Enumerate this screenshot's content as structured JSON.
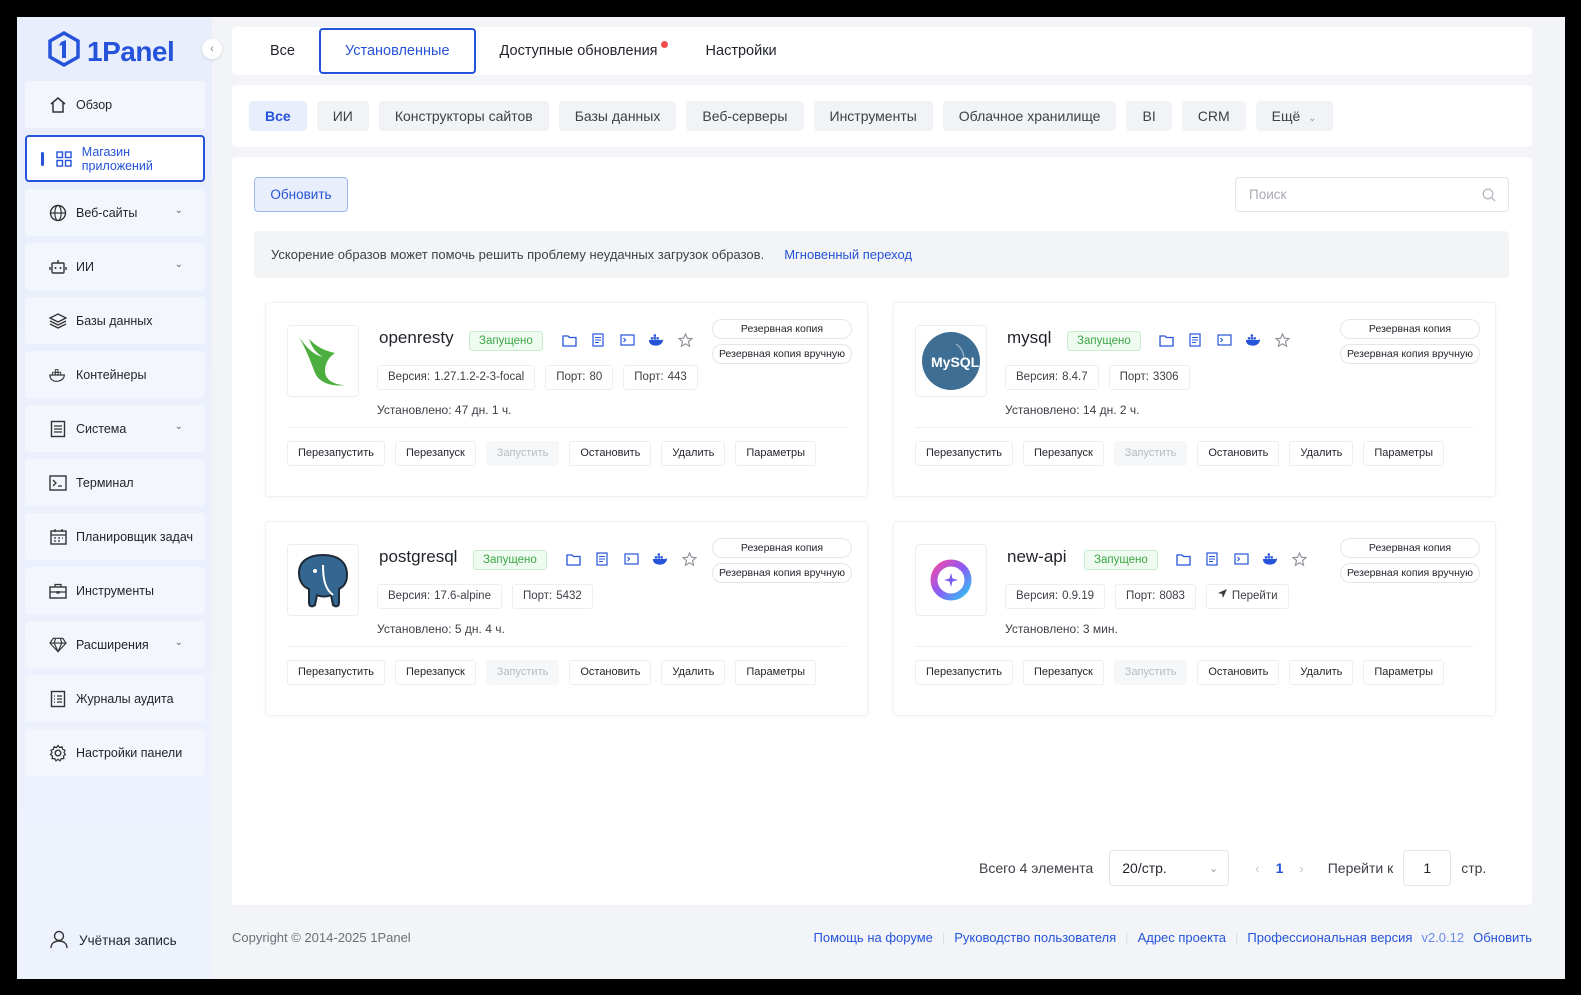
{
  "brand": {
    "name": "1Panel"
  },
  "sidebar": {
    "items": [
      {
        "label": "Обзор"
      },
      {
        "label": "Магазин приложений"
      },
      {
        "label": "Веб-сайты"
      },
      {
        "label": "ИИ"
      },
      {
        "label": "Базы данных"
      },
      {
        "label": "Контейнеры"
      },
      {
        "label": "Система"
      },
      {
        "label": "Терминал"
      },
      {
        "label": "Планировщик задач"
      },
      {
        "label": "Инструменты"
      },
      {
        "label": "Расширения"
      },
      {
        "label": "Журналы аудита"
      },
      {
        "label": "Настройки панели"
      }
    ],
    "account": "Учётная запись"
  },
  "top_tabs": [
    "Все",
    "Установленные",
    "Доступные обновления",
    "Настройки"
  ],
  "categories": [
    "Все",
    "ИИ",
    "Конструкторы сайтов",
    "Базы данных",
    "Веб-серверы",
    "Инструменты",
    "Облачное хранилище",
    "BI",
    "CRM",
    "Ещё"
  ],
  "toolbar": {
    "refresh": "Обновить",
    "search_placeholder": "Поиск"
  },
  "notice": {
    "text": "Ускорение образов может помочь решить проблему неудачных загрузок образов.",
    "link": "Мгновенный переход"
  },
  "common": {
    "status": "Запущено",
    "backup": "Резервная копия",
    "manual_backup": "Резервная копия вручную",
    "version_label": "Версия:",
    "port_label": "Порт:",
    "installed_label": "Установлено:",
    "goto": "Перейти",
    "actions": [
      "Перезапустить",
      "Перезапуск",
      "Запустить",
      "Остановить",
      "Удалить",
      "Параметры"
    ]
  },
  "apps": [
    {
      "name": "openresty",
      "version": "1.27.1.2-2-3-focal",
      "ports": [
        "80",
        "443"
      ],
      "installed": "47 дн. 1 ч."
    },
    {
      "name": "mysql",
      "version": "8.4.7",
      "ports": [
        "3306"
      ],
      "installed": "14 дн. 2 ч."
    },
    {
      "name": "postgresql",
      "version": "17.6-alpine",
      "ports": [
        "5432"
      ],
      "installed": "5 дн. 4 ч."
    },
    {
      "name": "new-api",
      "version": "0.9.19",
      "ports": [
        "8083"
      ],
      "installed": "3 мин."
    }
  ],
  "mysql_logo_text": "MySQL",
  "pagination": {
    "total": "Всего 4 элемента",
    "page_size": "20/стр.",
    "current": "1",
    "goto_label": "Перейти к",
    "goto_value": "1",
    "suffix": "стр."
  },
  "footer": {
    "copyright": "Copyright © 2014-2025 1Panel",
    "links": [
      "Помощь на форуме",
      "Руководство пользователя",
      "Адрес проекта",
      "Профессиональная версия"
    ],
    "version": "v2.0.12",
    "update": "Обновить"
  },
  "colors": {
    "accent": "#2553d9",
    "running": "#3ba745",
    "badge": "#f24e4e",
    "sidebar_bg": "#e9eefc"
  }
}
